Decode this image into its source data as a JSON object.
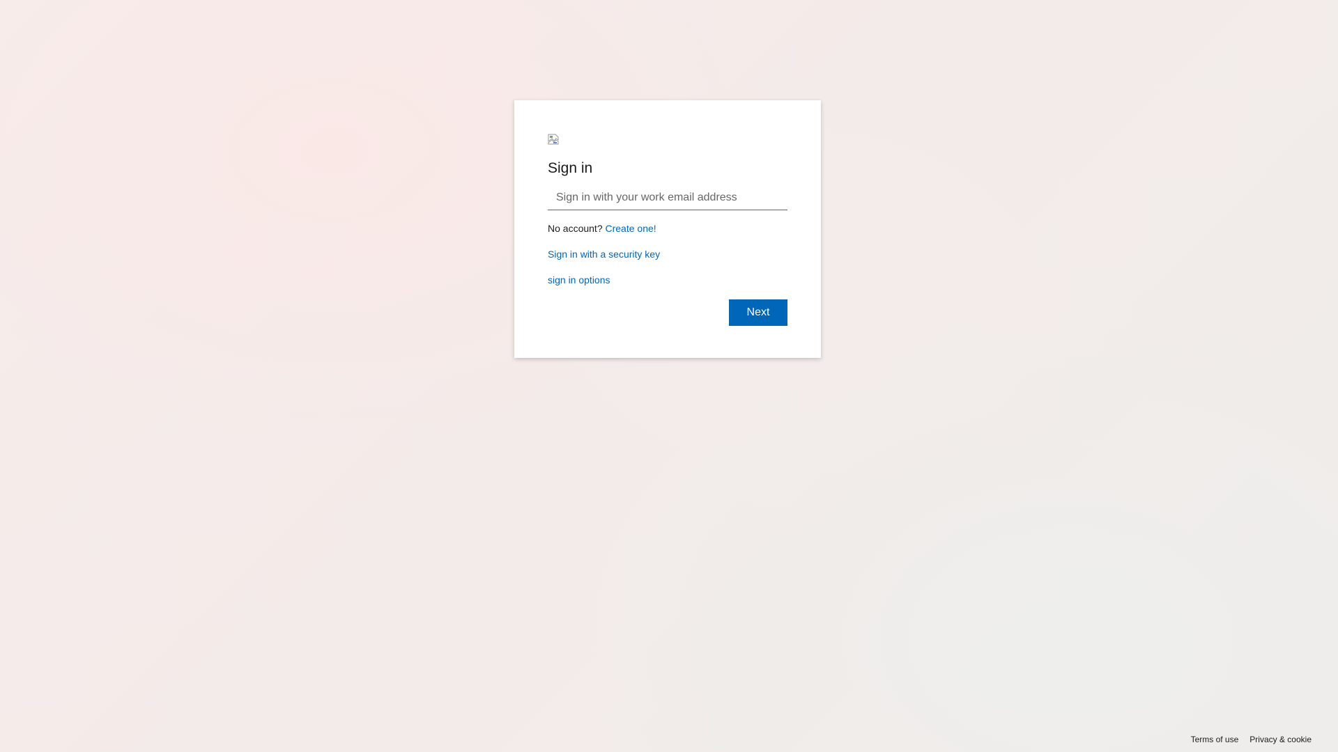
{
  "card": {
    "logo_icon": "broken-image-icon",
    "title": "Sign in",
    "email_placeholder": "Sign in with your work email address",
    "email_value": "",
    "no_account_text": "No account?",
    "create_link": "Create one!",
    "security_key_link": "Sign in with a security key",
    "options_link": "sign in options",
    "next_label": "Next"
  },
  "footer": {
    "terms": "Terms of use",
    "privacy": "Privacy & cookie"
  },
  "colors": {
    "accent": "#0067b8",
    "text": "#1b1b1b"
  }
}
